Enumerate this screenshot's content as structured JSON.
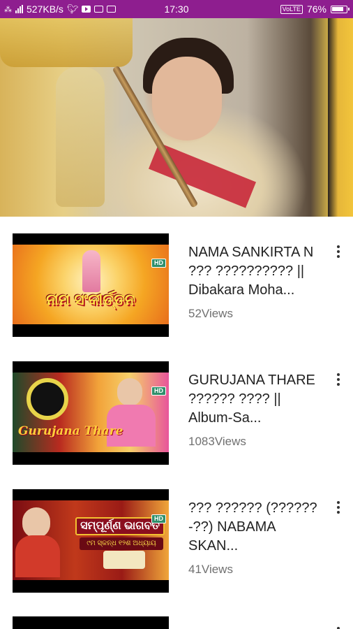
{
  "status_bar": {
    "network_speed": "527KB/s",
    "time": "17:30",
    "volte": "VoLTE",
    "battery": "76%",
    "icons": [
      "sim-icon",
      "signal-icon",
      "twitter-icon",
      "youtube-icon",
      "gmail-icon",
      "photo-icon",
      "volte-icon",
      "battery-icon"
    ]
  },
  "player": {
    "description_icon": "video-frame"
  },
  "videos": [
    {
      "title": "NAMA SANKIRTA N ??? ?????????? || Dibakara Moha...",
      "views": "52Views",
      "thumb_title": "ନାମ ସଂକୀର୍ତ୍ତନ",
      "hd": "HD",
      "thumb_colors": [
        "#f5a623",
        "#e86e1c",
        "#fbd36a"
      ]
    },
    {
      "title": "GURUJANA THARE ?????? ???? || Album-Sa...",
      "views": "1083Views",
      "thumb_title": "Gurujana Thare",
      "hd": "HD",
      "thumb_colors": [
        "#b82a1f",
        "#f2a33a",
        "#e8559b"
      ]
    },
    {
      "title": "??? ?????? (??????-??) NABAMA SKAN...",
      "views": "41Views",
      "thumb_banner": "ସମ୍ପୂର୍ଣ୍ଣ ଭାଗବତ",
      "thumb_sub": "୯ମ ସ୍କନ୍ଧ ୧୨ଶ ଅଧ୍ୟାୟ",
      "hd": "HD",
      "thumb_colors": [
        "#7a0c12",
        "#c0391b",
        "#f0a63a"
      ]
    }
  ],
  "accent_color": "#8e1e8f"
}
